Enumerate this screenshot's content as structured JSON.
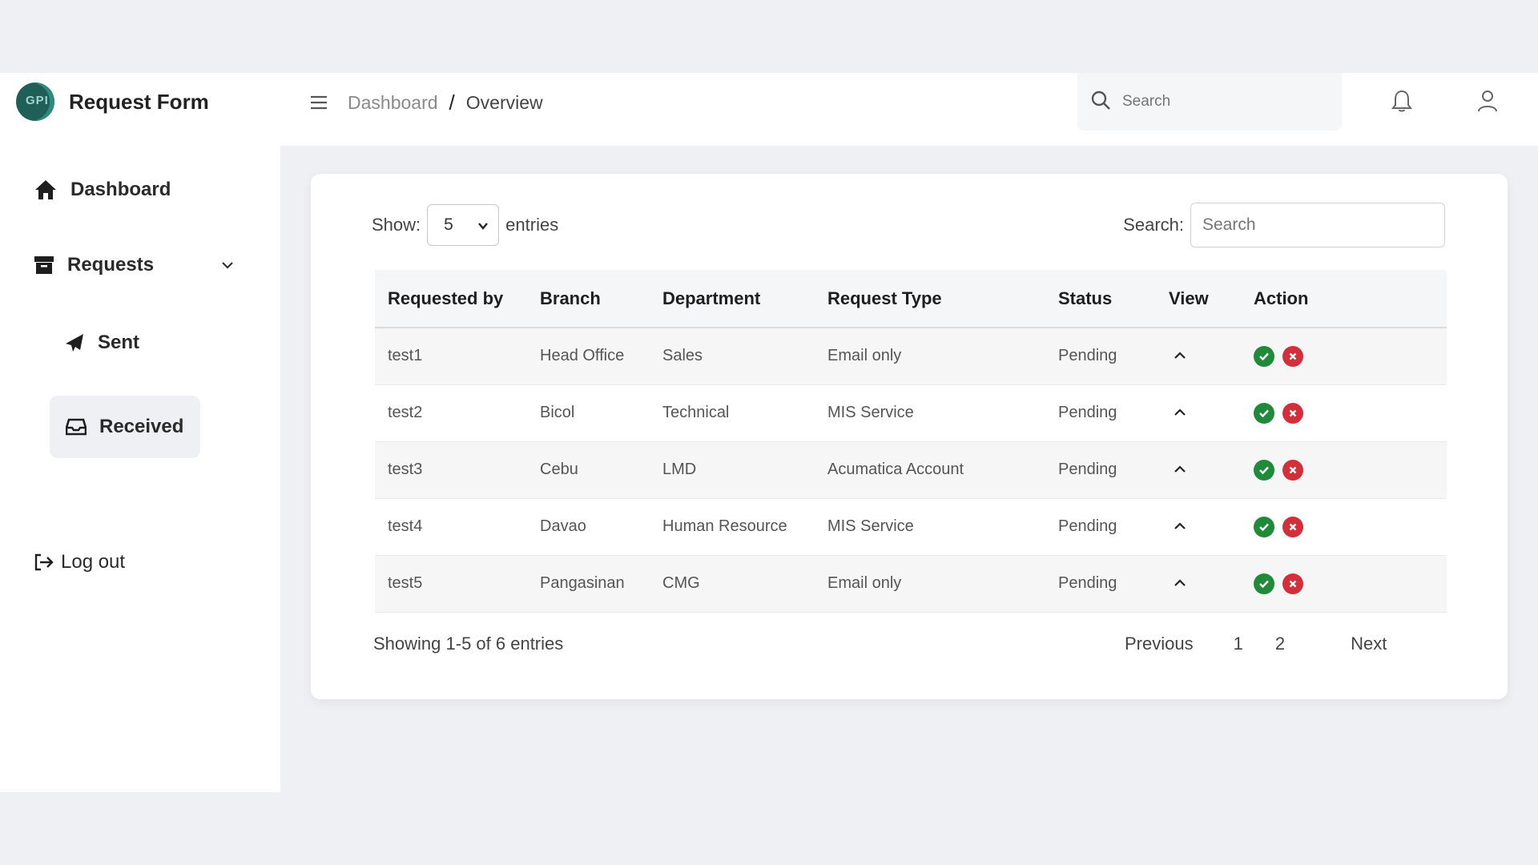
{
  "brand": {
    "logo_text": "GPI",
    "title": "Request Form"
  },
  "sidebar": {
    "items": [
      {
        "label": "Dashboard",
        "icon": "home-icon"
      },
      {
        "label": "Requests",
        "icon": "archive-icon"
      },
      {
        "label": "Sent",
        "icon": "paper-plane-icon"
      },
      {
        "label": "Received",
        "icon": "inbox-icon"
      }
    ],
    "logout_label": "Log out"
  },
  "header": {
    "breadcrumb": [
      "Dashboard",
      "Overview"
    ],
    "breadcrumb_sep": "/",
    "search_placeholder": "Search"
  },
  "table_controls": {
    "show_label": "Show:",
    "entries_value": "5",
    "entries_label": "entries",
    "search_label": "Search:",
    "search_placeholder": "Search"
  },
  "table": {
    "columns": [
      "Requested by",
      "Branch",
      "Department",
      "Request Type",
      "Status",
      "View",
      "Action"
    ],
    "rows": [
      {
        "requested_by": "test1",
        "branch": "Head Office",
        "department": "Sales",
        "request_type": "Email only",
        "status": "Pending"
      },
      {
        "requested_by": "test2",
        "branch": "Bicol",
        "department": "Technical",
        "request_type": "MIS Service",
        "status": "Pending"
      },
      {
        "requested_by": "test3",
        "branch": "Cebu",
        "department": "LMD",
        "request_type": "Acumatica Account",
        "status": "Pending"
      },
      {
        "requested_by": "test4",
        "branch": "Davao",
        "department": "Human Resource",
        "request_type": "MIS Service",
        "status": "Pending"
      },
      {
        "requested_by": "test5",
        "branch": "Pangasinan",
        "department": "CMG",
        "request_type": "Email only",
        "status": "Pending"
      }
    ]
  },
  "pagination": {
    "info": "Showing 1-5 of 6 entries",
    "previous": "Previous",
    "pages": [
      "1",
      "2"
    ],
    "next": "Next"
  },
  "colors": {
    "approve": "#1f8a3a",
    "reject": "#d32f3a",
    "background": "#eef0f4"
  }
}
